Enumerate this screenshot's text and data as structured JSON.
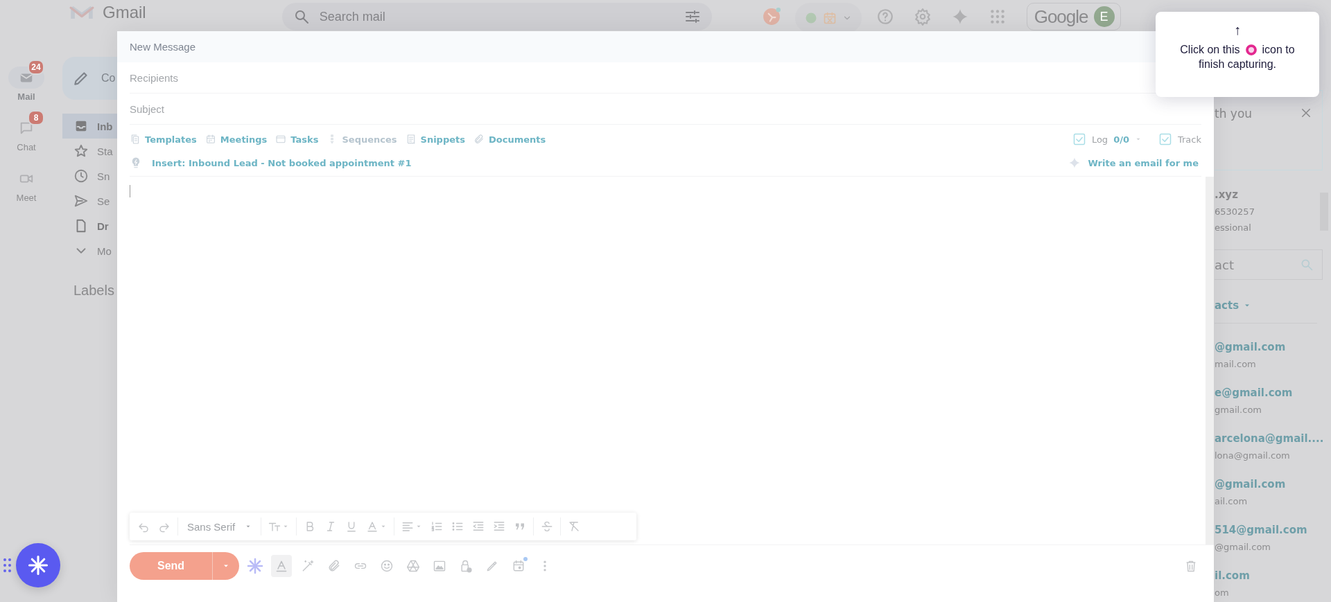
{
  "app_bar": {
    "logo": "Gmail",
    "search_placeholder": "Search mail",
    "account_logo": "Google",
    "avatar": "E"
  },
  "rail": [
    {
      "label": "Mail",
      "badge": "24",
      "selected": true
    },
    {
      "label": "Chat",
      "badge": "8",
      "selected": false
    },
    {
      "label": "Meet",
      "selected": false
    }
  ],
  "nav": {
    "compose": "Co",
    "items": [
      {
        "label": "Inb",
        "selected": true,
        "unread": true
      },
      {
        "label": "Sta",
        "selected": false,
        "unread": false
      },
      {
        "label": "Sn",
        "selected": false,
        "unread": false
      },
      {
        "label": "Se",
        "selected": false,
        "unread": false
      },
      {
        "label": "Dr",
        "selected": false,
        "unread": true
      },
      {
        "label": "Mo",
        "selected": false,
        "unread": false
      }
    ],
    "labels_heading": "Labels"
  },
  "side_panel": {
    "banner": "th you",
    "contact_name": ".xyz",
    "contact_phone": "6530257",
    "contact_role": "essional",
    "search_placeholder": "act",
    "section": "acts",
    "contacts": [
      {
        "name": "@gmail.com",
        "email": "mail.com"
      },
      {
        "name": "e@gmail.com",
        "email": "gmail.com"
      },
      {
        "name": "arcelona@gmail....",
        "email": "lona@gmail.com"
      },
      {
        "name": "@gmail.com",
        "email": "ail.com"
      },
      {
        "name": "514@gmail.com",
        "email": "@gmail.com"
      },
      {
        "name": "il.com",
        "email": "om"
      }
    ]
  },
  "compose": {
    "title": "New Message",
    "recipients_placeholder": "Recipients",
    "subject_placeholder": "Subject",
    "tools": [
      {
        "label": "Templates",
        "disabled": false
      },
      {
        "label": "Meetings",
        "disabled": false
      },
      {
        "label": "Tasks",
        "disabled": false
      },
      {
        "label": "Sequences",
        "disabled": true
      },
      {
        "label": "Snippets",
        "disabled": false
      },
      {
        "label": "Documents",
        "disabled": false
      }
    ],
    "insert": "Insert: Inbound Lead - Not booked appointment #1",
    "log": {
      "label": "Log",
      "count": "0/0",
      "checked": true
    },
    "track": {
      "label": "Track",
      "checked": true
    },
    "ai_prompt": "Write an email for me",
    "formatting_open": true,
    "font": "Sans Serif",
    "send": "Send"
  },
  "tooltip": {
    "arrow": "↑",
    "lead": "Click on this",
    "trail": "icon to",
    "last_line": "finish capturing."
  }
}
